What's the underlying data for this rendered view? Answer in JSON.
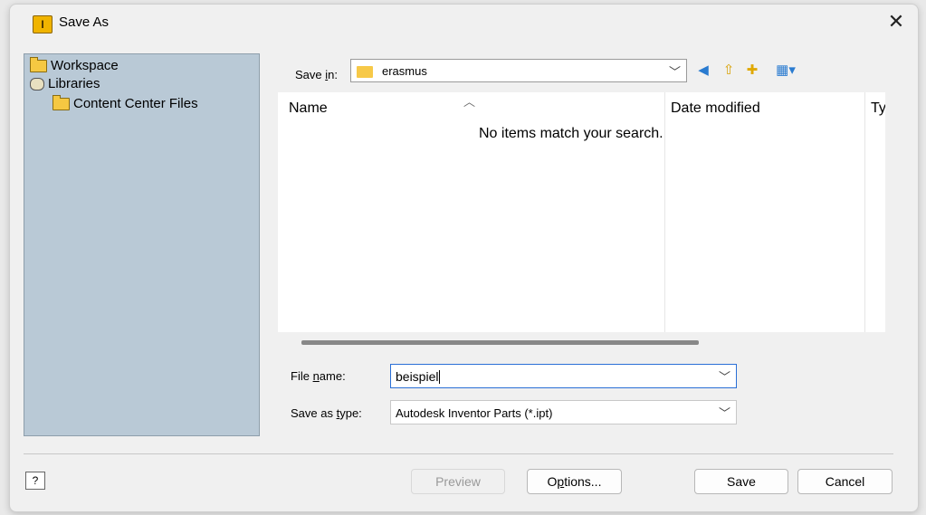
{
  "window": {
    "title": "Save As",
    "app_icon_letter": "I"
  },
  "sidebar": {
    "items": [
      {
        "label": "Workspace",
        "icon": "folder-icon"
      },
      {
        "label": "Libraries",
        "icon": "libraries-icon"
      },
      {
        "label": "Content Center Files",
        "icon": "folder-icon"
      }
    ]
  },
  "save_in": {
    "label_pre": "Save ",
    "label_u": "i",
    "label_post": "n:",
    "value": "erasmus"
  },
  "toolbar": {
    "icons": [
      "back-icon",
      "up-folder-icon",
      "new-folder-icon",
      "view-menu-icon"
    ]
  },
  "file_list": {
    "columns": [
      "Name",
      "Date modified",
      "Typ"
    ],
    "empty_message": "No items match your search."
  },
  "file_name": {
    "label_pre": "File ",
    "label_u": "n",
    "label_post": "ame:",
    "value": "beispiel"
  },
  "file_type": {
    "label_pre": "Save as ",
    "label_u": "t",
    "label_post": "ype:",
    "value": "Autodesk Inventor Parts (*.ipt)"
  },
  "buttons": {
    "preview": "Preview",
    "options_pre": "O",
    "options_u": "p",
    "options_post": "tions...",
    "save": "Save",
    "cancel": "Cancel"
  },
  "colors": {
    "sidebar_bg": "#b9c9d6",
    "focus_border": "#2a6fd6"
  }
}
